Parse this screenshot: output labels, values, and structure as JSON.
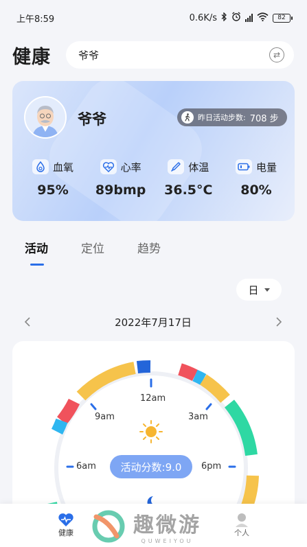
{
  "status_bar": {
    "time": "上午8:59",
    "net_speed": "0.6K/s",
    "battery": "82"
  },
  "header": {
    "title": "健康",
    "search_value": "爷爷"
  },
  "profile": {
    "name": "爷爷",
    "steps_label": "昨日活动步数:",
    "steps_value": "708 步",
    "metrics": [
      {
        "label": "血氧",
        "value": "95%",
        "icon": "drop-icon"
      },
      {
        "label": "心率",
        "value": "89bmp",
        "icon": "heart-rate-icon"
      },
      {
        "label": "体温",
        "value": "36.5°C",
        "icon": "thermometer-icon"
      },
      {
        "label": "电量",
        "value": "80%",
        "icon": "battery-icon"
      }
    ]
  },
  "tabs": [
    "活动",
    "定位",
    "趋势"
  ],
  "period": {
    "selected": "日"
  },
  "date": "2022年7月17日",
  "activity": {
    "clock_labels": {
      "top": "12am",
      "upper_left": "9am",
      "upper_right": "3am",
      "left": "6am",
      "right": "6pm"
    },
    "score_label": "活动分数:9.0",
    "ring_colors": {
      "yellow": "#f6c34b",
      "red": "#f0525c",
      "blue": "#2465d9",
      "cyan": "#2fb6f0",
      "green": "#2ed8a3"
    }
  },
  "bottom_nav": {
    "items": [
      {
        "label": "健康",
        "icon": "heart-icon"
      },
      {
        "label": "个人",
        "icon": "person-icon"
      }
    ],
    "watermark_text": "趣微游",
    "watermark_sub": "QUWEIYOU"
  }
}
